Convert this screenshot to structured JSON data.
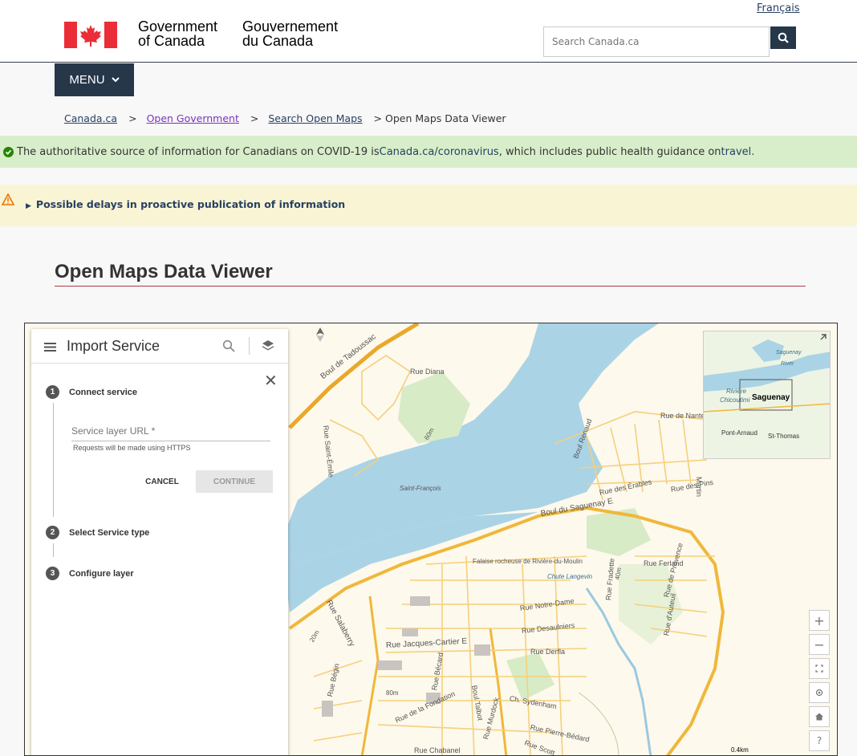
{
  "header": {
    "language_link": "Français",
    "signature_en": [
      "Government",
      "of Canada"
    ],
    "signature_fr": [
      "Gouvernement",
      "du Canada"
    ],
    "search_placeholder": "Search Canada.ca"
  },
  "menu": {
    "label": "MENU"
  },
  "breadcrumb": [
    {
      "label": "Canada.ca"
    },
    {
      "label": "Open Government"
    },
    {
      "label": "Search Open Maps"
    },
    {
      "label": "Open Maps Data Viewer"
    }
  ],
  "covid_notice": {
    "prefix": "The authoritative source of information for Canadians on COVID-19 is ",
    "link1": "Canada.ca/coronavirus",
    "middle": ", which includes public health guidance on ",
    "link2": "travel."
  },
  "warning": {
    "summary": "Possible delays in proactive publication of information"
  },
  "page_title": "Open Maps Data Viewer",
  "import_panel": {
    "title": "Import Service",
    "steps": [
      {
        "number": "1",
        "label": "Connect service"
      },
      {
        "number": "2",
        "label": "Select Service type"
      },
      {
        "number": "3",
        "label": "Configure layer"
      }
    ],
    "url_placeholder": "Service layer URL *",
    "hint": "Requests will be made using HTTPS",
    "cancel_label": "CANCEL",
    "continue_label": "CONTINUE"
  },
  "map": {
    "labels": {
      "boul_tadoussac": "Boul de Tadoussac",
      "rue_diana": "Rue Diana",
      "rue_st_emile": "Rue Saint-Émile",
      "saint_francois": "Saint-François",
      "boul_saguenay": "Boul du Saguenay E",
      "falaise": "Falaise rocheuse de Rivière-du-Moulin",
      "chute": "Chute Langevin",
      "rue_notre_dame": "Rue Notre-Dame",
      "rue_desaulniers": "Rue Desaulniers",
      "rue_derfla": "Rue Derfla",
      "rue_jacques_cartier": "Rue Jacques-Cartier E",
      "boul_talbot": "Boul Talbot",
      "ch_sydenham": "Ch. Sydenham",
      "rue_fondation": "Rue de la Fondation",
      "rue_pierre_bedard": "Rue Pierre-Bédard",
      "rue_scott": "Rue Scott",
      "rue_sababerry": "Rue Salaberry",
      "rue_begin": "Rue Bégin",
      "rue_ferland": "Rue Ferland",
      "rue_erables": "Rue des Érables",
      "rue_pins": "Rue des Pins",
      "rue_nantes": "Rue de Nantes",
      "martin": "Martin",
      "boul_renaud": "Boul Renaud",
      "rue_fradette": "Rue Fradette",
      "rue_provence": "Rue de Provence",
      "rue_auteuil": "Rue d'Auteuil",
      "rue_becard": "Rue Bécard",
      "rue_murdock": "Rue Murdock",
      "rue_chabanel": "Rue Chabanel",
      "m80": "80m",
      "m60": "60m",
      "m40": "40m",
      "m20": "20m"
    },
    "inset_labels": {
      "saguenay": "Saguenay",
      "riviere": "Rivière",
      "chicoutimi": "Chicoutimi",
      "pont_arnaud": "Pont-Arnaud",
      "st_thomas": "St-Thomas",
      "saguenay_river": "Saguenay",
      "river": "River"
    },
    "scale": "0.4km",
    "zoom_in": "+",
    "zoom_out": "−",
    "help": "?"
  },
  "colors": {
    "header_navy": "#26374a",
    "link_blue": "#284162",
    "visited_purple": "#7834bc",
    "covid_green_bg": "#d8eeca",
    "warning_bg": "#f9f4d4",
    "title_rule": "#af3c43",
    "water": "#aad3e6",
    "road": "#f0b73b"
  }
}
